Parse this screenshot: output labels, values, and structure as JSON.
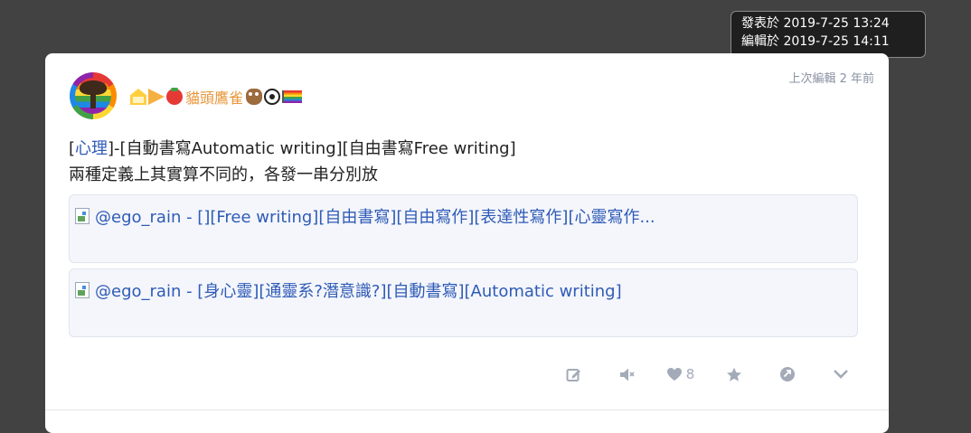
{
  "tooltip": {
    "posted": "發表於 2019-7-25 13:24",
    "edited": "編輯於 2019-7-25 14:11"
  },
  "post": {
    "edited_label": "上次編輯 2 年前",
    "username": "貓頭鷹雀",
    "content": {
      "line1_open": "[",
      "category": "心理",
      "line1_rest": "]-[自動書寫Automatic writing][自由書寫Free writing]",
      "line2": "兩種定義上其實算不同的，各發一串分別放"
    },
    "links": [
      {
        "text": "@ego_rain - [][Free writing][自由書寫][自由寫作][表達性寫作][心靈寫作..."
      },
      {
        "text": "@ego_rain - [身心靈][通靈系?潛意識?][自動書寫][Automatic writing]"
      }
    ],
    "actions": {
      "like_count": "8"
    }
  },
  "colors": {
    "background": "#424242",
    "card": "#ffffff",
    "username": "#e8963a",
    "link": "#2f5bb7",
    "action_icon": "#a3aab8"
  }
}
